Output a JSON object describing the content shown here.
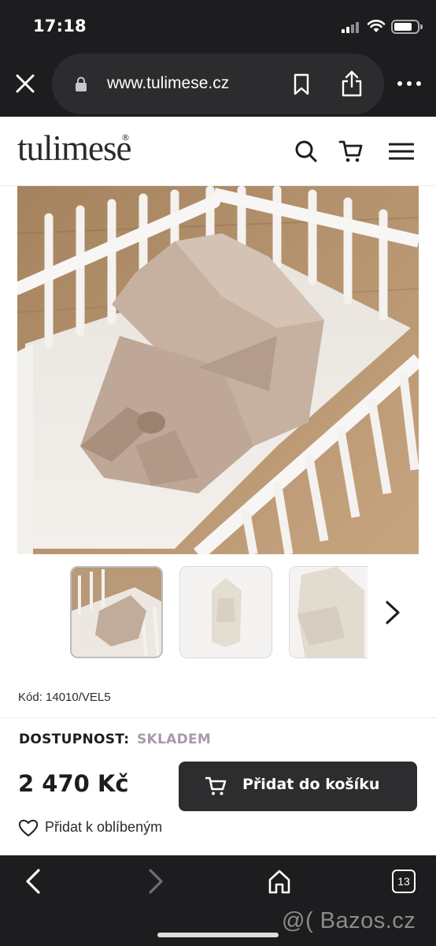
{
  "status_bar": {
    "time": "17:18"
  },
  "browser": {
    "url": "www.tulimese.cz",
    "icons": [
      "close-icon",
      "lock-icon",
      "bookmark-icon",
      "share-icon",
      "more-icon"
    ]
  },
  "site": {
    "logo": "tulimese",
    "logo_mark": "®",
    "icons": [
      "search-icon",
      "cart-icon",
      "menu-icon"
    ]
  },
  "product": {
    "code_label": "Kód: 14010/VEL5",
    "availability_label": "DOSTUPNOST:",
    "availability_value": "SKLADEM",
    "price": "2 470 Kč",
    "add_to_cart": "Přidat do košíku",
    "add_to_favorites": "Přidat k oblíbeným"
  },
  "bottom_bar": {
    "tabs_count": "13",
    "icons": [
      "back-icon",
      "forward-icon",
      "home-icon",
      "tabs-icon"
    ]
  },
  "watermark": "@( Bazos.cz",
  "colors": {
    "chrome": "#1d1d1f",
    "availability": "#a79aa9",
    "button": "#2d2d2f"
  }
}
